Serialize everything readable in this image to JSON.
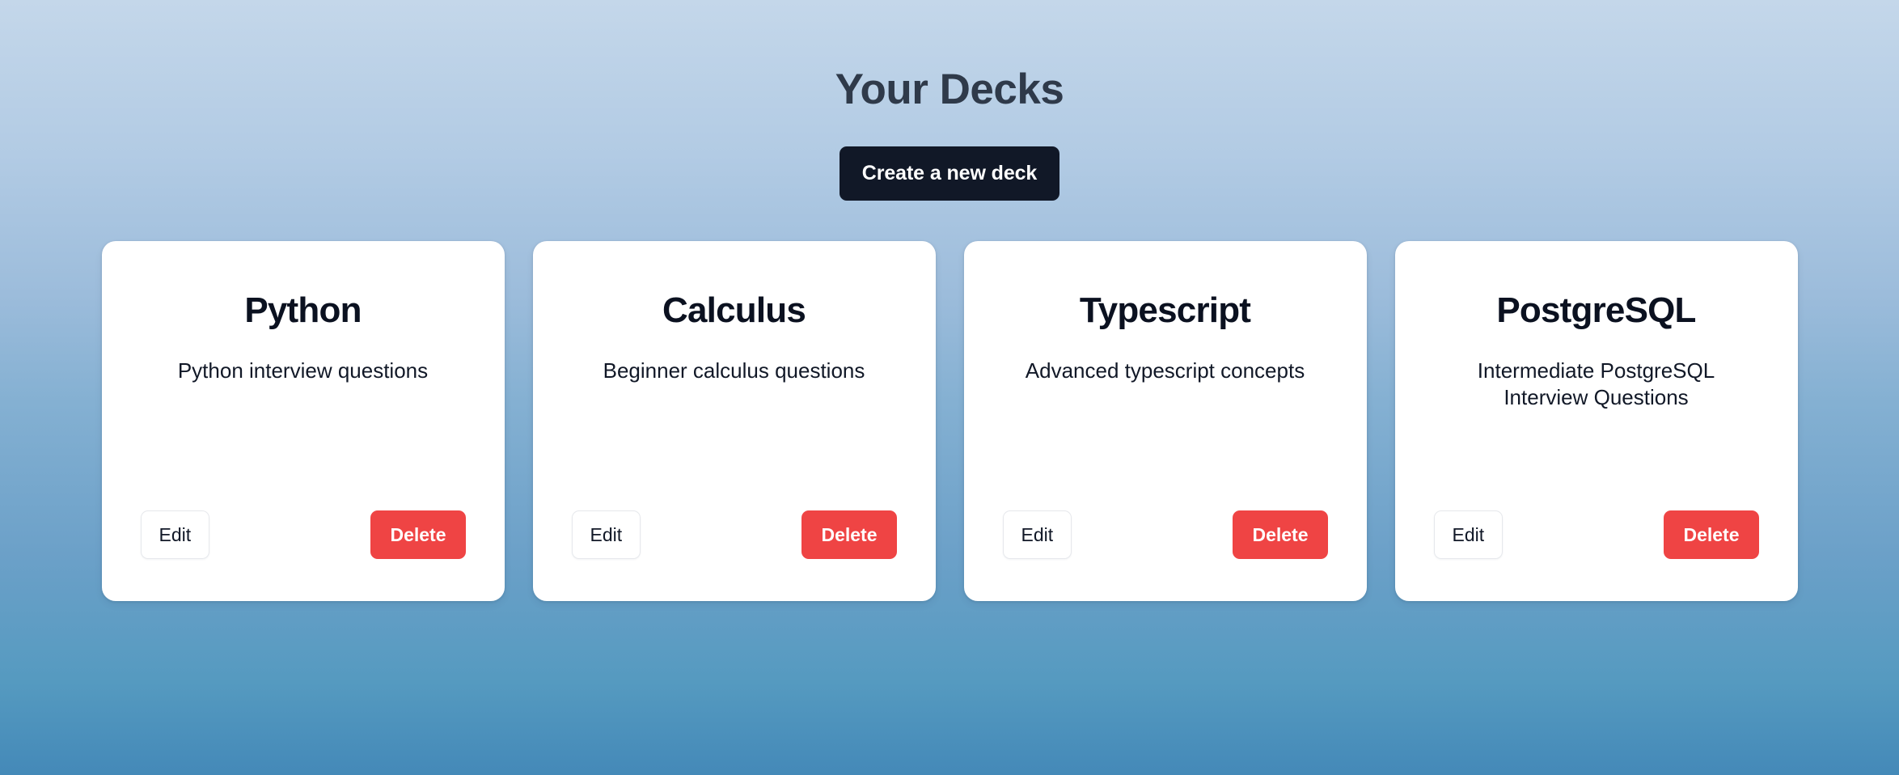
{
  "header": {
    "title": "Your Decks"
  },
  "toolbar": {
    "create_label": "Create a new deck"
  },
  "buttons": {
    "edit_label": "Edit",
    "delete_label": "Delete"
  },
  "colors": {
    "background_top": "#c4d7ea",
    "background_bottom": "#4489b8",
    "heading_text": "#2f3a4a",
    "create_button_bg": "#111827",
    "card_bg": "#ffffff",
    "card_title_text": "#0b1120",
    "edit_button_border": "#e6e8ec",
    "delete_button_bg": "#ef4444"
  },
  "decks": [
    {
      "title": "Python",
      "description": "Python interview questions",
      "edit_label": "Edit",
      "delete_label": "Delete"
    },
    {
      "title": "Calculus",
      "description": "Beginner calculus questions",
      "edit_label": "Edit",
      "delete_label": "Delete"
    },
    {
      "title": "Typescript",
      "description": "Advanced typescript concepts",
      "edit_label": "Edit",
      "delete_label": "Delete"
    },
    {
      "title": "PostgreSQL",
      "description": "Intermediate PostgreSQL Interview Questions",
      "edit_label": "Edit",
      "delete_label": "Delete"
    }
  ]
}
